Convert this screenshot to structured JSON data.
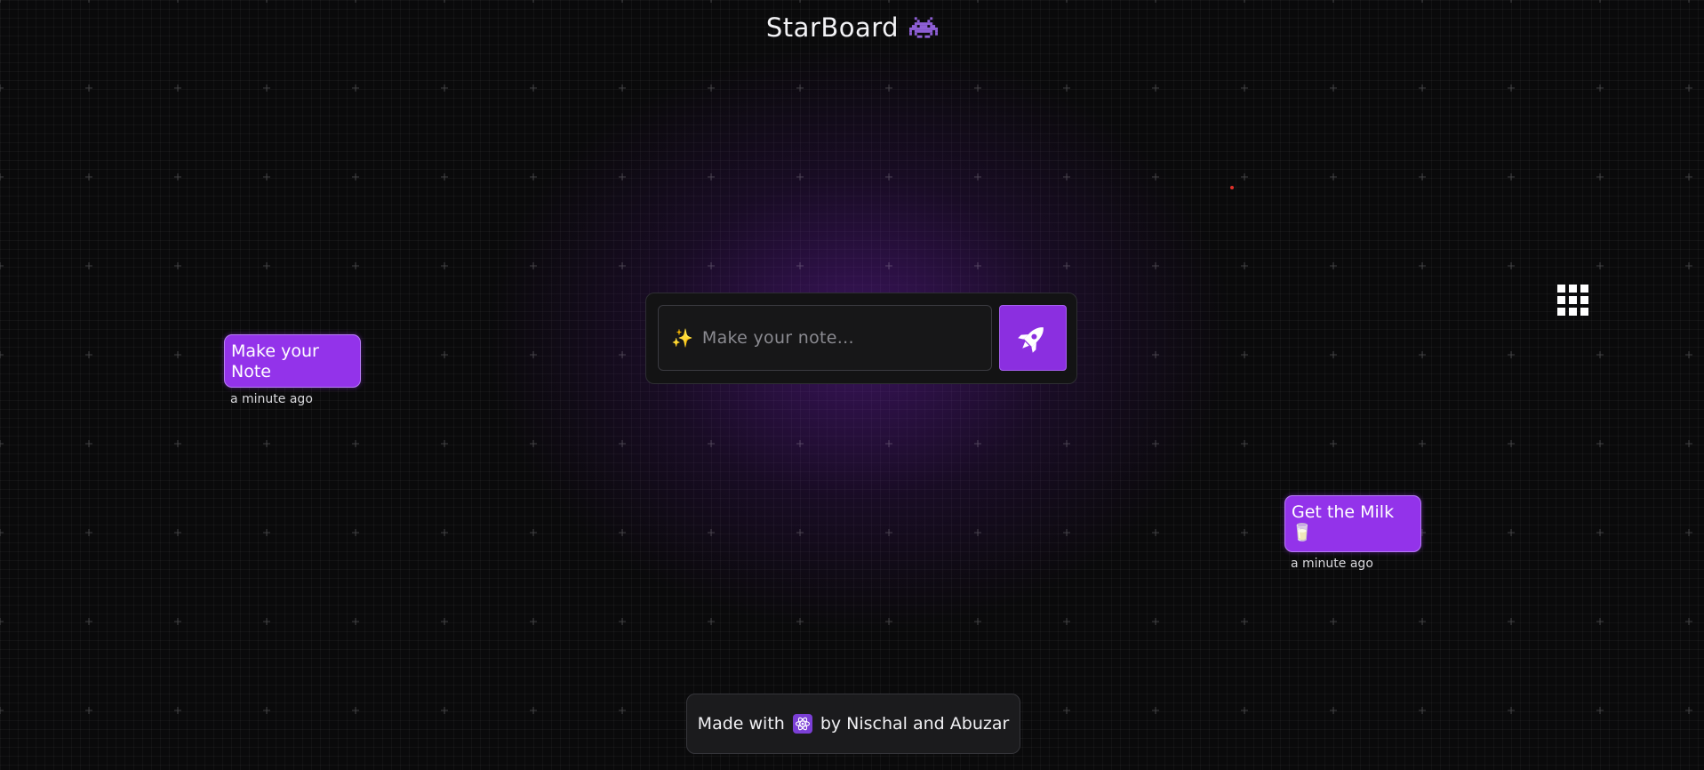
{
  "app": {
    "title": "StarBoard",
    "title_icon": "alien-monster-icon"
  },
  "composer": {
    "placeholder": "Make your note...",
    "leading_icon": "sparkles-icon",
    "submit_icon": "rocket-icon"
  },
  "notes": [
    {
      "text": "Make your Note",
      "time": "a minute ago"
    },
    {
      "text": "Get the Milk 🥛",
      "time": "a minute ago"
    }
  ],
  "footer": {
    "prefix": "Made with",
    "icon": "react-icon",
    "suffix": "by Nischal and Abuzar"
  },
  "colors": {
    "accent": "#9333ea",
    "background": "#0a0a0b",
    "glow": "#7e22ce"
  }
}
